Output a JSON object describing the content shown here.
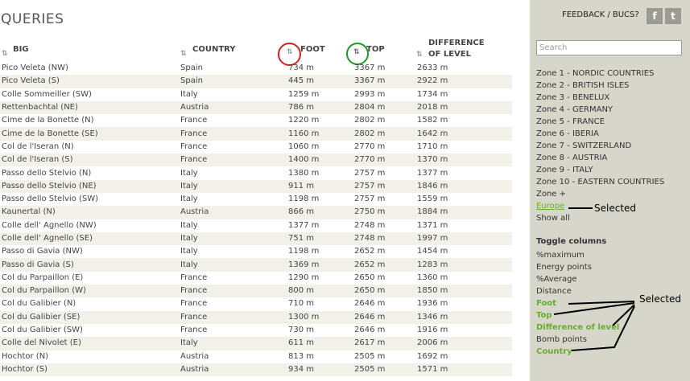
{
  "page": {
    "title": "QUERIES"
  },
  "columns": {
    "big": "BIG",
    "country": "COUNTRY",
    "foot": "FOOT",
    "top": "TOP",
    "difference_line1": "DIFFERENCE",
    "difference_line2": "OF LEVEL",
    "sort_glyph": "⇅"
  },
  "rows": [
    [
      "Pico Veleta (NW)",
      "Spain",
      "734 m",
      "3367 m",
      "2633 m"
    ],
    [
      "Pico Veleta (S)",
      "Spain",
      "445 m",
      "3367 m",
      "2922 m"
    ],
    [
      "Colle Sommeiller (SW)",
      "Italy",
      "1259 m",
      "2993 m",
      "1734 m"
    ],
    [
      "Rettenbachtal (NE)",
      "Austria",
      "786 m",
      "2804 m",
      "2018 m"
    ],
    [
      "Cime de la Bonette (N)",
      "France",
      "1220 m",
      "2802 m",
      "1582 m"
    ],
    [
      "Cime de la Bonette (SE)",
      "France",
      "1160 m",
      "2802 m",
      "1642 m"
    ],
    [
      "Col de l'Iseran (N)",
      "France",
      "1060 m",
      "2770 m",
      "1710 m"
    ],
    [
      "Col de l'Iseran (S)",
      "France",
      "1400 m",
      "2770 m",
      "1370 m"
    ],
    [
      "Passo dello Stelvio (N)",
      "Italy",
      "1380 m",
      "2757 m",
      "1377 m"
    ],
    [
      "Passo dello Stelvio (NE)",
      "Italy",
      "911 m",
      "2757 m",
      "1846 m"
    ],
    [
      "Passo dello Stelvio (SW)",
      "Italy",
      "1198 m",
      "2757 m",
      "1559 m"
    ],
    [
      "Kaunertal (N)",
      "Austria",
      "866 m",
      "2750 m",
      "1884 m"
    ],
    [
      "Colle dell' Agnello (NW)",
      "Italy",
      "1377 m",
      "2748 m",
      "1371 m"
    ],
    [
      "Colle dell' Agnello (SE)",
      "Italy",
      "751 m",
      "2748 m",
      "1997 m"
    ],
    [
      "Passo di Gavia (NW)",
      "Italy",
      "1198 m",
      "2652 m",
      "1454 m"
    ],
    [
      "Passo di Gavia (S)",
      "Italy",
      "1369 m",
      "2652 m",
      "1283 m"
    ],
    [
      "Col du Parpaillon (E)",
      "France",
      "1290 m",
      "2650 m",
      "1360 m"
    ],
    [
      "Col du Parpaillon (W)",
      "France",
      "800 m",
      "2650 m",
      "1850 m"
    ],
    [
      "Col du Galibier (N)",
      "France",
      "710 m",
      "2646 m",
      "1936 m"
    ],
    [
      "Col du Galibier (SE)",
      "France",
      "1300 m",
      "2646 m",
      "1346 m"
    ],
    [
      "Col du Galibier (SW)",
      "France",
      "730 m",
      "2646 m",
      "1916 m"
    ],
    [
      "Colle del Nivolet (E)",
      "Italy",
      "611 m",
      "2617 m",
      "2006 m"
    ],
    [
      "Hochtor (N)",
      "Austria",
      "813 m",
      "2505 m",
      "1692 m"
    ],
    [
      "Hochtor (S)",
      "Austria",
      "934 m",
      "2505 m",
      "1571 m"
    ]
  ],
  "sidebar": {
    "feedback": "FEEDBACK / BUCS?",
    "facebook_glyph": "f",
    "twitter_glyph": "t",
    "search": {
      "placeholder": "Search",
      "value": ""
    },
    "zones": [
      "Zone 1 - NORDIC COUNTRIES",
      "Zone 2 - BRITISH ISLES",
      "Zone 3 - BENELUX",
      "Zone 4 - GERMANY",
      "Zone 5 - FRANCE",
      "Zone 6 - IBERIA",
      "Zone 7 - SWITZERLAND",
      "Zone 8 - AUSTRIA",
      "Zone 9 - ITALY",
      "Zone 10 - EASTERN COUNTRIES",
      "Zone +",
      "Europe",
      "Show all"
    ],
    "active_zone": "Europe",
    "toggle_title": "Toggle columns",
    "toggles": [
      {
        "label": "%maximum",
        "selected": false
      },
      {
        "label": "Energy points",
        "selected": false
      },
      {
        "label": "%Average",
        "selected": false
      },
      {
        "label": "Distance",
        "selected": false
      },
      {
        "label": "Foot",
        "selected": true
      },
      {
        "label": "Top",
        "selected": true
      },
      {
        "label": "Difference of level",
        "selected": true
      },
      {
        "label": "Bomb points",
        "selected": false
      },
      {
        "label": "Country",
        "selected": true
      }
    ]
  },
  "annotations": {
    "europe_note": "Selected",
    "columns_note": "Selected"
  },
  "colors": {
    "sidebar_bg": "#d7d6cb",
    "selected_green": "#6aac2e",
    "circle_red": "#d62020",
    "circle_green": "#1d9a2d",
    "row_stripe": "#f1f1e9"
  }
}
